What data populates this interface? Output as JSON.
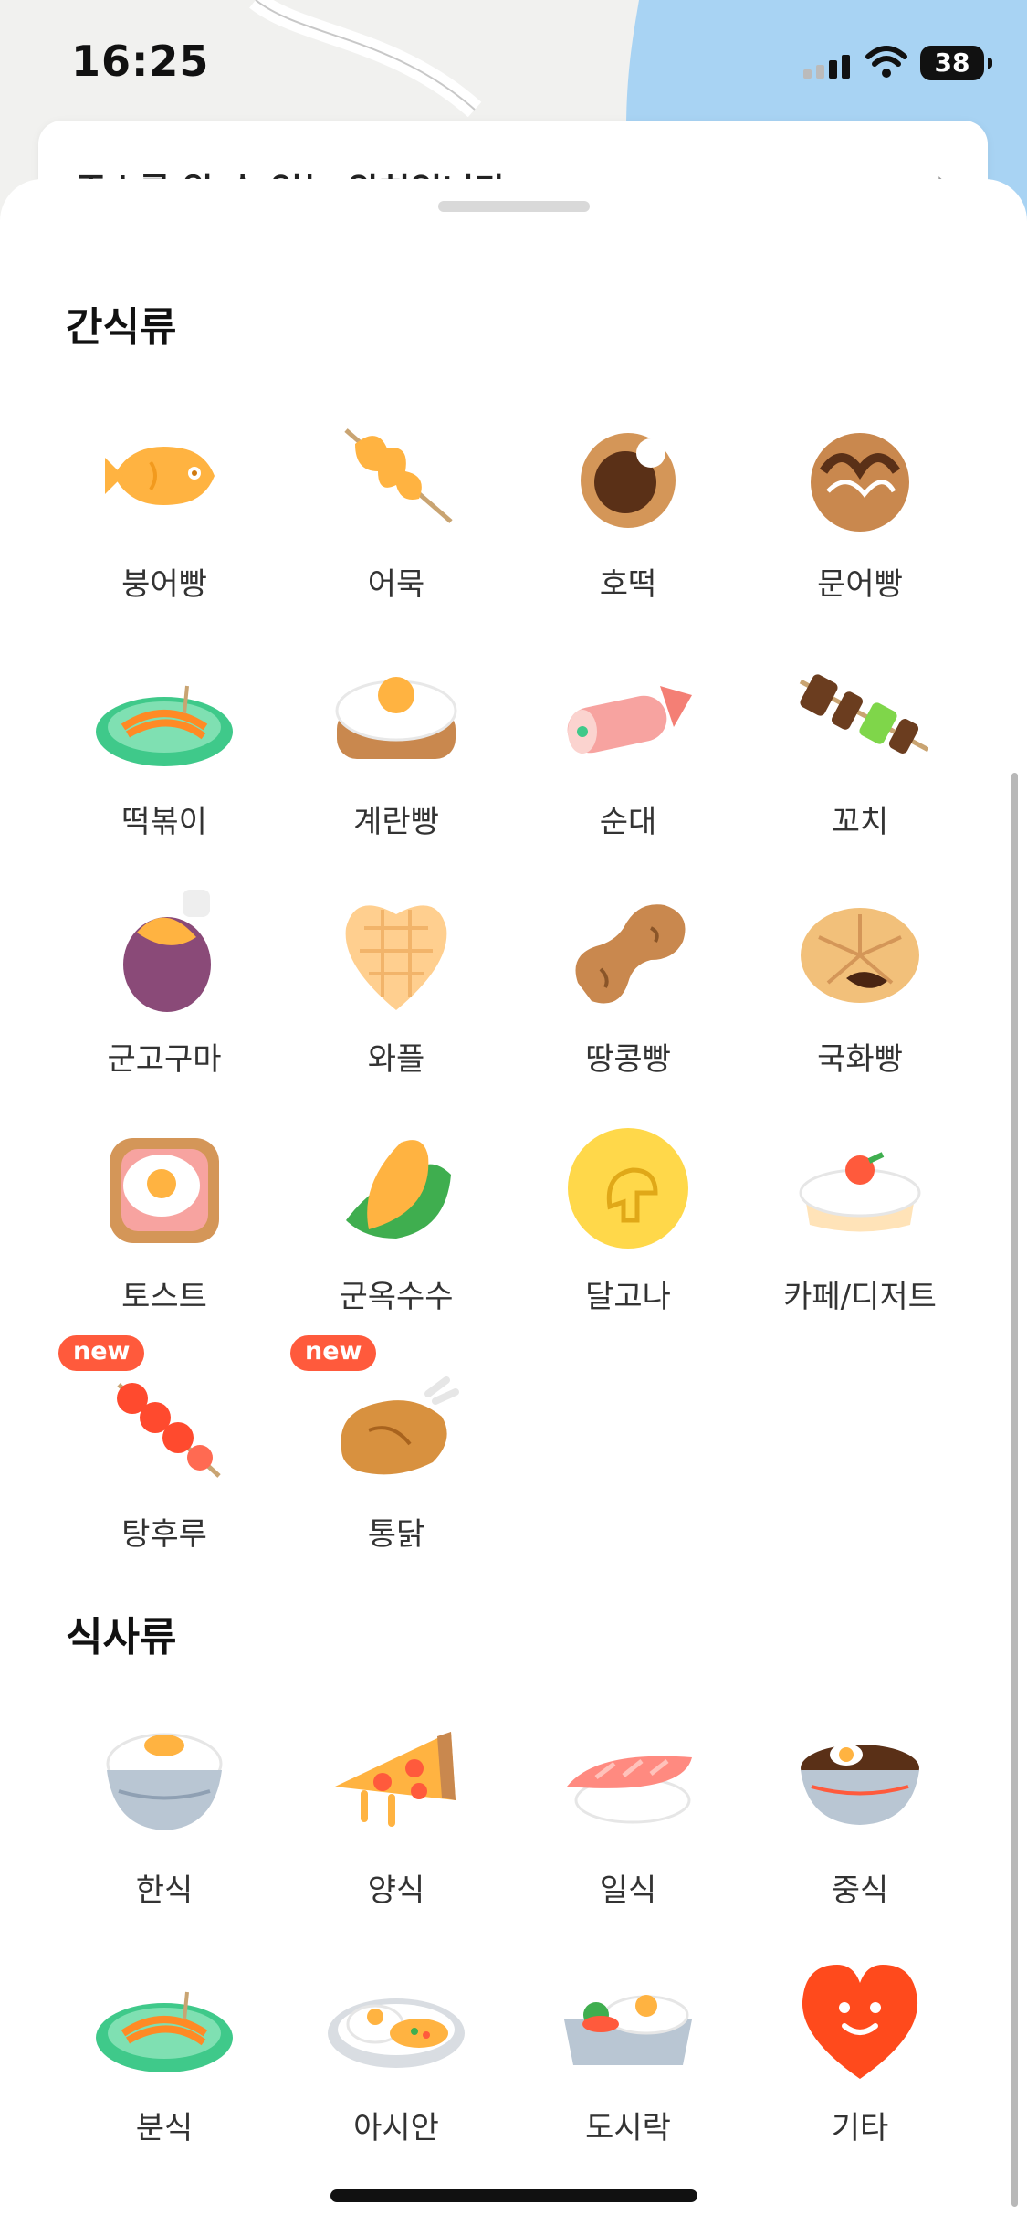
{
  "status": {
    "time": "16:25",
    "battery": "38"
  },
  "address_bar": {
    "text": "주소를 알 수 없는 위치입니다"
  },
  "sections": [
    {
      "title": "간식류",
      "items": [
        {
          "label": "붕어빵",
          "icon": "fish-bread-icon"
        },
        {
          "label": "어묵",
          "icon": "fishcake-skewer-icon"
        },
        {
          "label": "호떡",
          "icon": "hotteok-icon"
        },
        {
          "label": "문어빵",
          "icon": "takoyaki-icon"
        },
        {
          "label": "떡볶이",
          "icon": "tteokbokki-icon"
        },
        {
          "label": "계란빵",
          "icon": "egg-bread-icon"
        },
        {
          "label": "순대",
          "icon": "sundae-icon"
        },
        {
          "label": "꼬치",
          "icon": "skewer-icon"
        },
        {
          "label": "군고구마",
          "icon": "sweet-potato-icon"
        },
        {
          "label": "와플",
          "icon": "waffle-icon"
        },
        {
          "label": "땅콩빵",
          "icon": "peanut-bread-icon"
        },
        {
          "label": "국화빵",
          "icon": "chrysanthemum-bread-icon"
        },
        {
          "label": "토스트",
          "icon": "toast-icon"
        },
        {
          "label": "군옥수수",
          "icon": "corn-icon"
        },
        {
          "label": "달고나",
          "icon": "dalgona-icon"
        },
        {
          "label": "카페/디저트",
          "icon": "cake-icon"
        },
        {
          "label": "탕후루",
          "icon": "tanghulu-icon",
          "badge": "new"
        },
        {
          "label": "통닭",
          "icon": "fried-chicken-icon",
          "badge": "new"
        }
      ]
    },
    {
      "title": "식사류",
      "items": [
        {
          "label": "한식",
          "icon": "rice-bowl-icon"
        },
        {
          "label": "양식",
          "icon": "pizza-icon"
        },
        {
          "label": "일식",
          "icon": "sushi-icon"
        },
        {
          "label": "중식",
          "icon": "noodle-bowl-icon"
        },
        {
          "label": "분식",
          "icon": "tteokbokki-plate-icon"
        },
        {
          "label": "아시안",
          "icon": "curry-plate-icon"
        },
        {
          "label": "도시락",
          "icon": "lunchbox-icon"
        },
        {
          "label": "기타",
          "icon": "heart-face-icon"
        }
      ]
    }
  ]
}
